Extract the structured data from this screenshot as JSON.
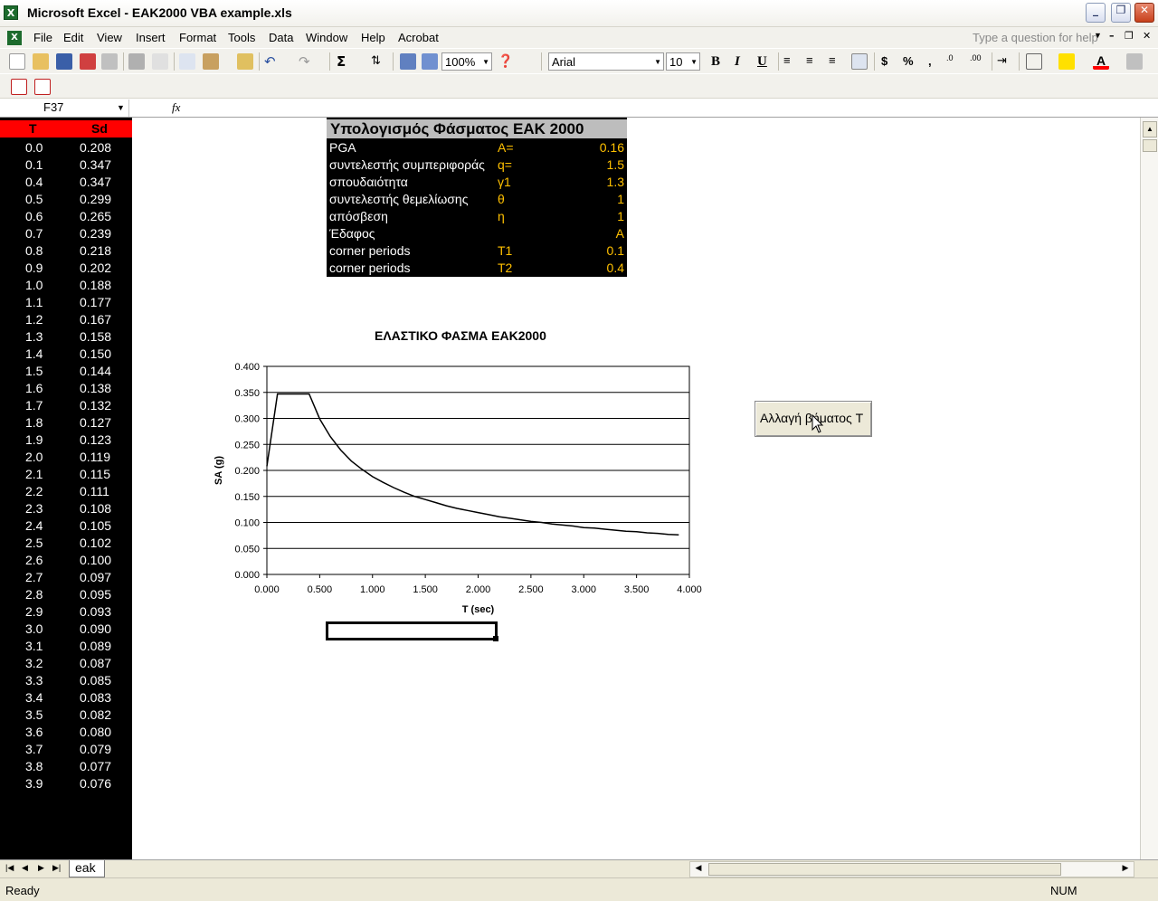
{
  "window": {
    "title": "Microsoft Excel - EAK2000 VBA example.xls"
  },
  "menu": {
    "items": [
      "File",
      "Edit",
      "View",
      "Insert",
      "Format",
      "Tools",
      "Data",
      "Window",
      "Help",
      "Acrobat"
    ],
    "ask_placeholder": "Type a question for help"
  },
  "toolbar": {
    "zoom": "100%",
    "font_name": "Arial",
    "font_size": "10"
  },
  "formula_bar": {
    "name_box": "F37",
    "fx": "fx",
    "content": ""
  },
  "table": {
    "headers": {
      "t": "T",
      "sd": "Sd"
    },
    "rows": [
      {
        "t": "0.0",
        "sd": "0.208"
      },
      {
        "t": "0.1",
        "sd": "0.347"
      },
      {
        "t": "0.4",
        "sd": "0.347"
      },
      {
        "t": "0.5",
        "sd": "0.299"
      },
      {
        "t": "0.6",
        "sd": "0.265"
      },
      {
        "t": "0.7",
        "sd": "0.239"
      },
      {
        "t": "0.8",
        "sd": "0.218"
      },
      {
        "t": "0.9",
        "sd": "0.202"
      },
      {
        "t": "1.0",
        "sd": "0.188"
      },
      {
        "t": "1.1",
        "sd": "0.177"
      },
      {
        "t": "1.2",
        "sd": "0.167"
      },
      {
        "t": "1.3",
        "sd": "0.158"
      },
      {
        "t": "1.4",
        "sd": "0.150"
      },
      {
        "t": "1.5",
        "sd": "0.144"
      },
      {
        "t": "1.6",
        "sd": "0.138"
      },
      {
        "t": "1.7",
        "sd": "0.132"
      },
      {
        "t": "1.8",
        "sd": "0.127"
      },
      {
        "t": "1.9",
        "sd": "0.123"
      },
      {
        "t": "2.0",
        "sd": "0.119"
      },
      {
        "t": "2.1",
        "sd": "0.115"
      },
      {
        "t": "2.2",
        "sd": "0.111"
      },
      {
        "t": "2.3",
        "sd": "0.108"
      },
      {
        "t": "2.4",
        "sd": "0.105"
      },
      {
        "t": "2.5",
        "sd": "0.102"
      },
      {
        "t": "2.6",
        "sd": "0.100"
      },
      {
        "t": "2.7",
        "sd": "0.097"
      },
      {
        "t": "2.8",
        "sd": "0.095"
      },
      {
        "t": "2.9",
        "sd": "0.093"
      },
      {
        "t": "3.0",
        "sd": "0.090"
      },
      {
        "t": "3.1",
        "sd": "0.089"
      },
      {
        "t": "3.2",
        "sd": "0.087"
      },
      {
        "t": "3.3",
        "sd": "0.085"
      },
      {
        "t": "3.4",
        "sd": "0.083"
      },
      {
        "t": "3.5",
        "sd": "0.082"
      },
      {
        "t": "3.6",
        "sd": "0.080"
      },
      {
        "t": "3.7",
        "sd": "0.079"
      },
      {
        "t": "3.8",
        "sd": "0.077"
      },
      {
        "t": "3.9",
        "sd": "0.076"
      }
    ]
  },
  "params": {
    "title": "Υπολογισμός Φάσματος ΕΑΚ 2000",
    "rows": [
      {
        "label": "PGA",
        "symbol": "A=",
        "value": "0.16"
      },
      {
        "label": "συντελεστής συμπεριφοράς",
        "symbol": "q=",
        "value": "1.5"
      },
      {
        "label": "σπουδαιότητα",
        "symbol": "γ1",
        "value": "1.3"
      },
      {
        "label": "συντελεστής θεμελίωσης",
        "symbol": "θ",
        "value": "1"
      },
      {
        "label": "απόσβεση",
        "symbol": "η",
        "value": "1"
      },
      {
        "label": "Έδαφος",
        "symbol": "",
        "value": "A"
      },
      {
        "label": "corner periods",
        "symbol": "T1",
        "value": "0.1"
      },
      {
        "label": "corner periods",
        "symbol": "T2",
        "value": "0.4"
      }
    ]
  },
  "chart_data": {
    "type": "line",
    "title": "ΕΛΑΣΤΙΚΟ ΦΑΣΜΑ ΕΑΚ2000",
    "xlabel": "T (sec)",
    "ylabel": "SA (g)",
    "xlim": [
      0,
      4
    ],
    "ylim": [
      0,
      0.4
    ],
    "xticks": [
      "0.000",
      "0.500",
      "1.000",
      "1.500",
      "2.000",
      "2.500",
      "3.000",
      "3.500",
      "4.000"
    ],
    "yticks": [
      "0.000",
      "0.050",
      "0.100",
      "0.150",
      "0.200",
      "0.250",
      "0.300",
      "0.350",
      "0.400"
    ],
    "grid": "horizontal",
    "series": [
      {
        "x": [
          0.0,
          0.1,
          0.4,
          0.5,
          0.6,
          0.7,
          0.8,
          0.9,
          1.0,
          1.1,
          1.2,
          1.3,
          1.4,
          1.5,
          1.6,
          1.7,
          1.8,
          1.9,
          2.0,
          2.1,
          2.2,
          2.3,
          2.4,
          2.5,
          2.6,
          2.7,
          2.8,
          2.9,
          3.0,
          3.1,
          3.2,
          3.3,
          3.4,
          3.5,
          3.6,
          3.7,
          3.8,
          3.9
        ],
        "y": [
          0.208,
          0.347,
          0.347,
          0.299,
          0.265,
          0.239,
          0.218,
          0.202,
          0.188,
          0.177,
          0.167,
          0.158,
          0.15,
          0.144,
          0.138,
          0.132,
          0.127,
          0.123,
          0.119,
          0.115,
          0.111,
          0.108,
          0.105,
          0.102,
          0.1,
          0.097,
          0.095,
          0.093,
          0.09,
          0.089,
          0.087,
          0.085,
          0.083,
          0.082,
          0.08,
          0.079,
          0.077,
          0.076
        ],
        "color": "#000000"
      }
    ]
  },
  "macro_button": {
    "label": "Αλλαγή βήματος T"
  },
  "sheet_tabs": [
    "eak"
  ],
  "status": {
    "text": "Ready",
    "num": "NUM"
  },
  "colors": {
    "header_red": "#ff0000",
    "param_gold": "#ffc000",
    "title_gray": "#bdbdbd"
  }
}
